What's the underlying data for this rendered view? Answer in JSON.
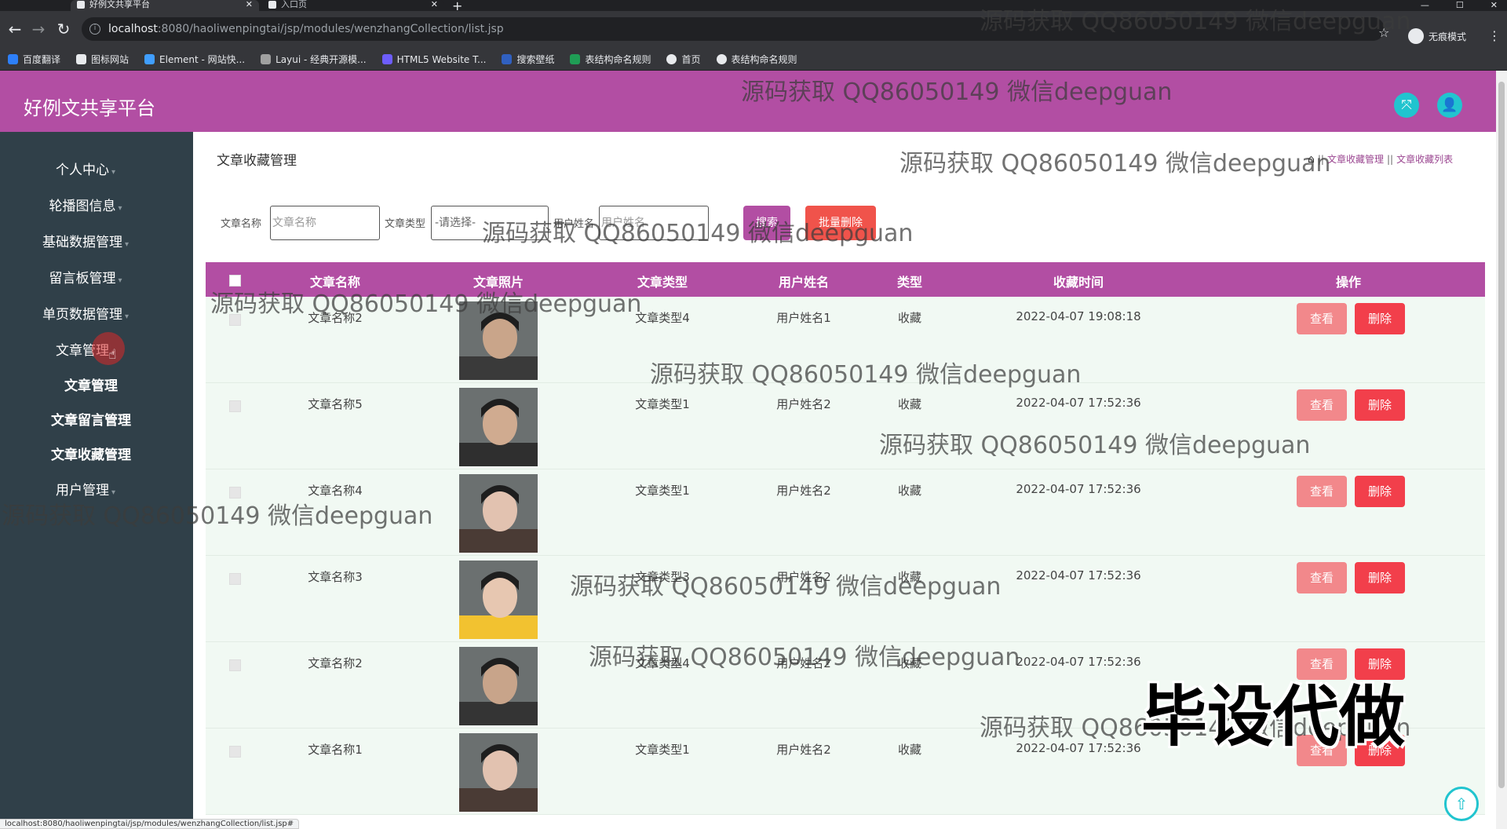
{
  "browser": {
    "tabs": [
      {
        "label": "好例文共享平台",
        "active": true
      },
      {
        "label": "入口页",
        "active": false
      }
    ],
    "url_host": "localhost",
    "url_path": ":8080/haoliwenpingtai/jsp/modules/wenzhangCollection/list.jsp",
    "incognito_label": "无痕模式",
    "bookmarks": [
      "百度翻译",
      "图标网站",
      "Element - 网站快...",
      "Layui - 经典开源模...",
      "HTML5 Website T...",
      "搜索壁纸",
      "表结构命名规则",
      "首页",
      "表结构命名规则"
    ],
    "status_url": "localhost:8080/haoliwenpingtai/jsp/modules/wenzhangCollection/list.jsp#"
  },
  "header": {
    "title": "好例文共享平台"
  },
  "sidebar": {
    "items": [
      "个人中心",
      "轮播图信息",
      "基础数据管理",
      "留言板管理",
      "单页数据管理",
      "文章管理"
    ],
    "subitems": [
      "文章管理",
      "文章留言管理",
      "文章收藏管理"
    ],
    "bottom_item": "用户管理"
  },
  "main": {
    "heading": "文章收藏管理",
    "breadcrumb": [
      "文章收藏管理",
      "文章收藏列表"
    ]
  },
  "search": {
    "name_label": "文章名称",
    "name_placeholder": "文章名称",
    "type_label": "文章类型",
    "type_value": "-请选择-",
    "user_label": "用户姓名",
    "user_placeholder": "用户姓名",
    "search_button": "搜索",
    "batch_delete_button": "批量删除"
  },
  "table": {
    "columns": [
      "文章名称",
      "文章照片",
      "文章类型",
      "用户姓名",
      "类型",
      "收藏时间",
      "操作"
    ],
    "view_label": "查看",
    "delete_label": "删除",
    "rows": [
      {
        "name": "文章名称2",
        "type": "文章类型4",
        "user": "用户姓名1",
        "kind": "收藏",
        "time": "2022-04-07 19:08:18"
      },
      {
        "name": "文章名称5",
        "type": "文章类型1",
        "user": "用户姓名2",
        "kind": "收藏",
        "time": "2022-04-07 17:52:36"
      },
      {
        "name": "文章名称4",
        "type": "文章类型1",
        "user": "用户姓名2",
        "kind": "收藏",
        "time": "2022-04-07 17:52:36"
      },
      {
        "name": "文章名称3",
        "type": "文章类型3",
        "user": "用户姓名2",
        "kind": "收藏",
        "time": "2022-04-07 17:52:36"
      },
      {
        "name": "文章名称2",
        "type": "文章类型4",
        "user": "用户姓名2",
        "kind": "收藏",
        "time": "2022-04-07 17:52:36"
      },
      {
        "name": "文章名称1",
        "type": "文章类型1",
        "user": "用户姓名2",
        "kind": "收藏",
        "time": "2022-04-07 17:52:36"
      }
    ]
  },
  "overlay": {
    "watermark": "源码获取 QQ86050149 微信deepguan",
    "big_text": "毕设代做"
  },
  "colors": {
    "accent": "#b24ea3",
    "sidebar": "#304049",
    "teal": "#21c4cf",
    "danger": "#f23f4b",
    "view": "#f2888b",
    "row_bg": "#f1f9f3"
  }
}
